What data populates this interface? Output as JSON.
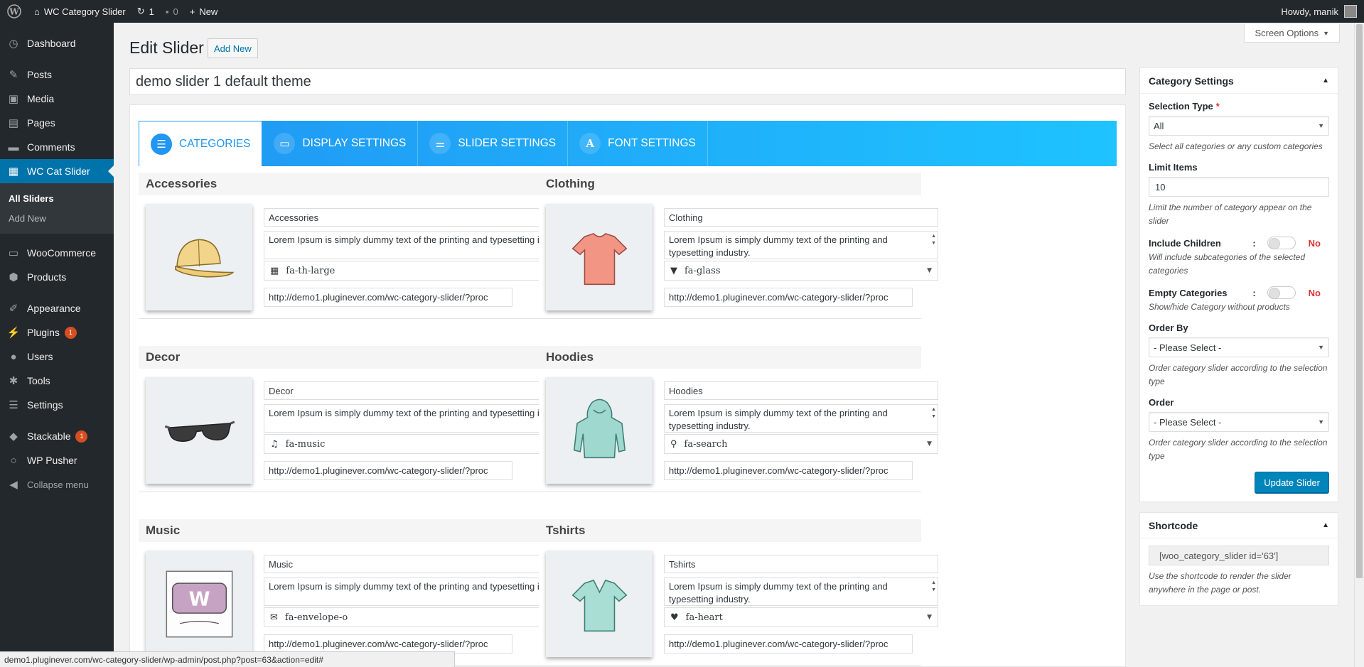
{
  "adminbar": {
    "site_name": "WC Category Slider",
    "updates_count": "1",
    "comments_count": "0",
    "new_label": "New",
    "howdy": "Howdy, manik"
  },
  "sidebar": {
    "items_top": [
      {
        "label": "Dashboard",
        "icon": "dashboard-icon"
      }
    ],
    "items_content": [
      {
        "label": "Posts",
        "icon": "pin-icon"
      },
      {
        "label": "Media",
        "icon": "media-icon"
      },
      {
        "label": "Pages",
        "icon": "pages-icon"
      },
      {
        "label": "Comments",
        "icon": "comment-icon"
      }
    ],
    "active_item": {
      "label": "WC Cat Slider",
      "icon": "slides-icon"
    },
    "submenu": [
      {
        "label": "All Sliders"
      },
      {
        "label": "Add New"
      }
    ],
    "items_shop": [
      {
        "label": "WooCommerce",
        "icon": "woo-icon"
      },
      {
        "label": "Products",
        "icon": "box-icon"
      }
    ],
    "items_admin": [
      {
        "label": "Appearance",
        "icon": "brush-icon"
      },
      {
        "label": "Plugins",
        "icon": "plug-icon",
        "badge": "1"
      },
      {
        "label": "Users",
        "icon": "user-icon"
      },
      {
        "label": "Tools",
        "icon": "wrench-icon"
      },
      {
        "label": "Settings",
        "icon": "settings-icon"
      }
    ],
    "items_extra": [
      {
        "label": "Stackable",
        "icon": "stack-icon",
        "badge": "1"
      },
      {
        "label": "WP Pusher",
        "icon": "circle-icon"
      }
    ],
    "collapse_label": "Collapse menu"
  },
  "header": {
    "title": "Edit Slider",
    "add_new": "Add New",
    "screen_options": "Screen Options"
  },
  "post_title": "demo slider 1 default theme",
  "tabs": [
    {
      "label": "CATEGORIES",
      "icon": "list-icon"
    },
    {
      "label": "DISPLAY SETTINGS",
      "icon": "monitor-icon"
    },
    {
      "label": "SLIDER SETTINGS",
      "icon": "sliders-icon"
    },
    {
      "label": "FONT SETTINGS",
      "icon": "font-icon"
    }
  ],
  "categories": [
    {
      "title": "Accessories",
      "name": "Accessories",
      "icon": "fa-th-large",
      "icon_glyph": "th-large-icon",
      "image": "cap-image"
    },
    {
      "title": "Clothing",
      "name": "Clothing",
      "icon": "fa-glass",
      "icon_glyph": "glass-icon",
      "image": "tshirt-image"
    },
    {
      "title": "Decor",
      "name": "Decor",
      "icon": "fa-music",
      "icon_glyph": "music-icon",
      "image": "sunglasses-image"
    },
    {
      "title": "Hoodies",
      "name": "Hoodies",
      "icon": "fa-search",
      "icon_glyph": "search-icon",
      "image": "hoodie-image"
    },
    {
      "title": "Music",
      "name": "Music",
      "icon": "fa-envelope-o",
      "icon_glyph": "envelope-icon",
      "image": "woo-album-image"
    },
    {
      "title": "Tshirts",
      "name": "Tshirts",
      "icon": "fa-heart",
      "icon_glyph": "heart-icon",
      "image": "vneck-image"
    }
  ],
  "category_desc": "Lorem Ipsum is simply dummy text of the printing and typesetting industry.",
  "category_url": "http://demo1.pluginever.com/wc-category-slider/?proc",
  "category_url_partial": "ory-slider/?proc",
  "settings": {
    "title": "Category Settings",
    "selection_type_label": "Selection Type",
    "selection_type_value": "All",
    "selection_type_hint": "Select all categories or any custom categories",
    "limit_label": "Limit Items",
    "limit_value": "10",
    "limit_hint": "Limit the number of category appear on the slider",
    "children_label": "Include Children",
    "children_value": "No",
    "children_hint": "Will include subcategories of the selected categories",
    "empty_label": "Empty Categories",
    "empty_value": "No",
    "empty_hint": "Show/hide Category without products",
    "orderby_label": "Order By",
    "orderby_value": "- Please Select -",
    "orderby_hint": "Order category slider according to the selection type",
    "order_label": "Order",
    "order_value": "- Please Select -",
    "order_hint": "Order category slider according to the selection type",
    "update_button": "Update Slider"
  },
  "shortcode": {
    "title": "Shortcode",
    "value": "[woo_category_slider id='63']",
    "hint": "Use the shortcode to render the slider anywhere in the page or post."
  },
  "status_url": "demo1.pluginever.com/wc-category-slider/wp-admin/post.php?post=63&action=edit#",
  "colors": {
    "accent": "#0073aa",
    "tab_gradient_start": "#2196f3",
    "tab_gradient_end": "#1ec3ff",
    "toggle_off": "#dc3232"
  }
}
